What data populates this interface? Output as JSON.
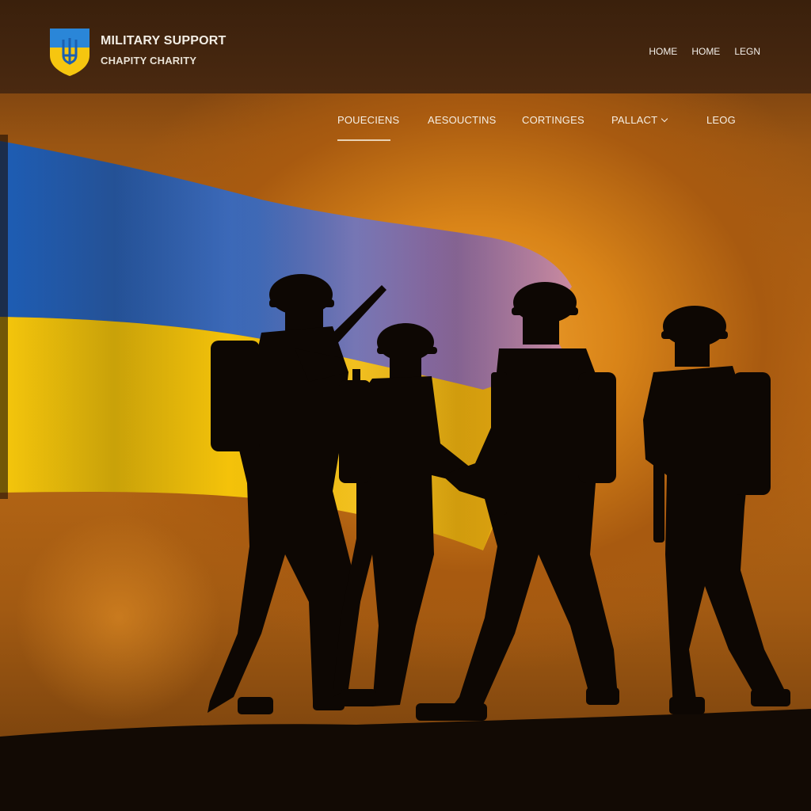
{
  "brand": {
    "title": "MILITARY SUPPORT",
    "subtitle": "CHAPITY CHARITY",
    "logo_icon": "ukraine-trident-shield-icon"
  },
  "top_nav": {
    "links": [
      "HOME",
      "HOME",
      "LEGN"
    ]
  },
  "main_nav": {
    "items": [
      "POUECIENS",
      "AESOUCTINS",
      "CORTINGES",
      "PALLACT",
      "LEOG"
    ],
    "active_index": 0,
    "dropdown_index": 3
  },
  "colors": {
    "flag_blue": "#1f5fb0",
    "flag_yellow": "#f2c20c",
    "header_bg": "#3a200c",
    "sky_orange": "#d98418",
    "silhouette": "#0d0703"
  }
}
